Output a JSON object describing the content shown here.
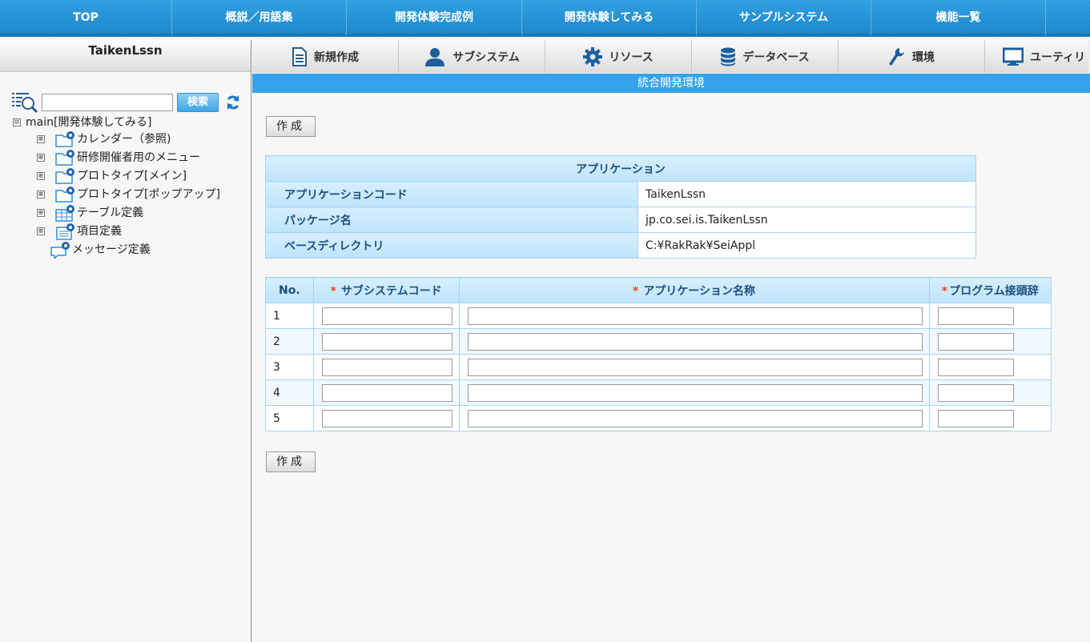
{
  "topnav": {
    "items": [
      "TOP",
      "概説／用語集",
      "開発体験完成例",
      "開発体験してみる",
      "サンプルシステム",
      "機能一覧"
    ]
  },
  "leftpanel": {
    "title": "TaikenLssn",
    "search_button": "検索",
    "tree_root": "main[開発体験してみる]",
    "tree_root_expander": "⊟",
    "nodes": [
      {
        "label": "カレンダー（参照)",
        "expander": "⊞",
        "icon": "folder-gear-icon"
      },
      {
        "label": "研修開催者用のメニュー",
        "expander": "⊞",
        "icon": "folder-gear-icon"
      },
      {
        "label": "プロトタイプ[メイン]",
        "expander": "⊞",
        "icon": "folder-gear-icon"
      },
      {
        "label": "プロトタイプ[ポップアップ]",
        "expander": "⊞",
        "icon": "folder-gear-icon"
      },
      {
        "label": "テーブル定義",
        "expander": "⊞",
        "icon": "table-gear-icon"
      },
      {
        "label": "項目定義",
        "expander": "⊞",
        "icon": "document-gear-icon"
      },
      {
        "label": "メッセージ定義",
        "expander": "",
        "icon": "message-gear-icon"
      }
    ]
  },
  "toolbar": {
    "items": [
      {
        "label": "新規作成",
        "icon": "new-document-icon"
      },
      {
        "label": "サブシステム",
        "icon": "user-icon"
      },
      {
        "label": "リソース",
        "icon": "gear-icon"
      },
      {
        "label": "データベース",
        "icon": "database-icon"
      },
      {
        "label": "環境",
        "icon": "wrench-icon"
      },
      {
        "label": "ユーティリ",
        "icon": "monitor-icon"
      }
    ]
  },
  "title_bar": "統合開発環境",
  "create_button": "作成",
  "app_table": {
    "caption": "アプリケーション",
    "rows": [
      {
        "key": "アプリケーションコード",
        "value": "TaikenLssn"
      },
      {
        "key": "パッケージ名",
        "value": "jp.co.sei.is.TaikenLssn"
      },
      {
        "key": "ベースディレクトリ",
        "value": "C:¥RakRak¥SeiAppl"
      }
    ]
  },
  "entry_table": {
    "headers": {
      "no": "No.",
      "subsystem_code": "サブシステムコード",
      "app_name": "アプリケーション名称",
      "prefix": "プログラム接頭辞"
    },
    "required_mark": "*",
    "rows": [
      "1",
      "2",
      "3",
      "4",
      "5"
    ]
  },
  "colors": {
    "topnav": "#1a86cc",
    "title_bar": "#35a2ec",
    "table_header": "#c9e9fc",
    "required": "#e8481e"
  }
}
